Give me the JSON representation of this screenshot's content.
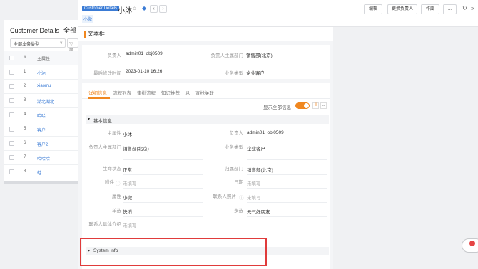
{
  "list_page": {
    "title": "Customer Details",
    "scope": "全部",
    "filter": "全部业务类型",
    "filter2": "筛",
    "header": {
      "num": "#",
      "name": "主属性"
    },
    "rows": [
      {
        "num": "1",
        "name": "小沐"
      },
      {
        "num": "2",
        "name": "xiaomu"
      },
      {
        "num": "3",
        "name": "湖北湖北"
      },
      {
        "num": "4",
        "name": "哈哈"
      },
      {
        "num": "5",
        "name": "客户"
      },
      {
        "num": "6",
        "name": "客户2"
      },
      {
        "num": "7",
        "name": "哈哈哈"
      },
      {
        "num": "8",
        "name": "蛙"
      }
    ]
  },
  "header": {
    "badge": "Customer Details",
    "title": "小沐",
    "sub_label": "小微",
    "buttons": {
      "edit": "编辑",
      "change_owner": "更换负责人",
      "void": "作废",
      "more": "..."
    }
  },
  "section_title": "文本框",
  "summary": {
    "owner_label": "负责人",
    "owner_value": "admin01_obj0509",
    "dept_label": "负责人主属部门",
    "dept_value": "销售部(北京)",
    "modified_label": "最后修改时间",
    "modified_value": "2023-01-10 16:26",
    "biztype_label": "业务类型",
    "biztype_value": "企业客户"
  },
  "tabs": [
    "详细信息",
    "流程列表",
    "审批流程",
    "知识推荐",
    "从",
    "查找关联"
  ],
  "show_all_label": "显示全部信息",
  "basic_info_title": "基本信息",
  "fields": {
    "main_attr": {
      "label": "主属性",
      "value": "小沐"
    },
    "owner": {
      "label": "负责人",
      "value": "admin01_obj0509"
    },
    "owner_dept": {
      "label": "负责人主属部门",
      "value": "销售部(北京)"
    },
    "biz_type": {
      "label": "业务类型",
      "value": "企业客户"
    },
    "life_status": {
      "label": "生命状态",
      "value": "正常"
    },
    "belong_dept": {
      "label": "归属部门",
      "value": "销售部(北京)"
    },
    "attachment": {
      "label": "附件",
      "value": "未填写"
    },
    "date": {
      "label": "日期",
      "value": "未填写"
    },
    "attribute": {
      "label": "属性",
      "value": "小微"
    },
    "contact_pic": {
      "label": "联系人照片",
      "value": "未填写"
    },
    "single": {
      "label": "单选",
      "value": "快消"
    },
    "multi": {
      "label": "多选",
      "value": "元气好朋友"
    },
    "contact_intro": {
      "label": "联系人具体介绍",
      "value": "未填写"
    }
  },
  "system_info_title": "System Info",
  "colors": {
    "accent": "#f0871f",
    "brand": "#3a7bd5",
    "highlight": "#e03b3b"
  }
}
